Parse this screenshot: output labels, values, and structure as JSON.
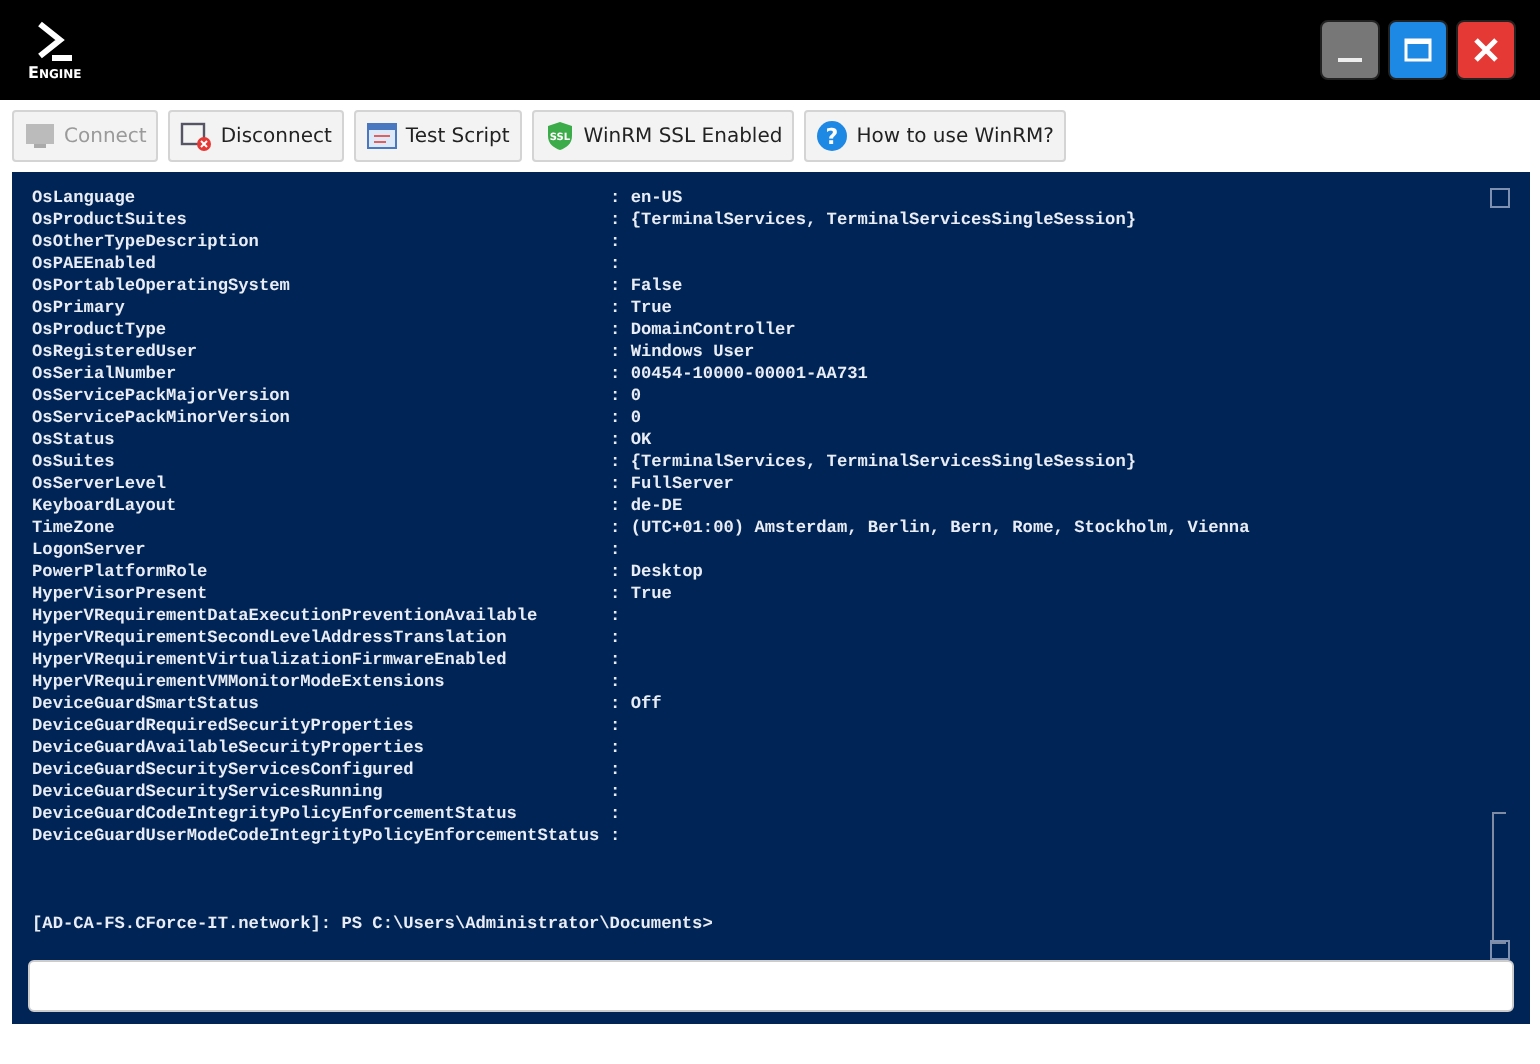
{
  "logo": {
    "text": "Engine"
  },
  "toolbar": [
    {
      "label": "Connect",
      "kind": "monitor",
      "disabled": true
    },
    {
      "label": "Disconnect",
      "kind": "disconnect",
      "disabled": false
    },
    {
      "label": "Test Script",
      "kind": "script",
      "disabled": false
    },
    {
      "label": "WinRM SSL Enabled",
      "kind": "shield",
      "icon_text": "SSL",
      "disabled": false
    },
    {
      "label": "How to use WinRM?",
      "kind": "help",
      "icon_text": "?",
      "disabled": false
    }
  ],
  "console": {
    "rows": [
      {
        "name": "OsLanguage",
        "value": ": en-US"
      },
      {
        "name": "OsProductSuites",
        "value": ": {TerminalServices, TerminalServicesSingleSession}"
      },
      {
        "name": "OsOtherTypeDescription",
        "value": ":"
      },
      {
        "name": "OsPAEEnabled",
        "value": ":"
      },
      {
        "name": "OsPortableOperatingSystem",
        "value": ": False"
      },
      {
        "name": "OsPrimary",
        "value": ": True"
      },
      {
        "name": "OsProductType",
        "value": ": DomainController"
      },
      {
        "name": "OsRegisteredUser",
        "value": ": Windows User"
      },
      {
        "name": "OsSerialNumber",
        "value": ": 00454-10000-00001-AA731"
      },
      {
        "name": "OsServicePackMajorVersion",
        "value": ": 0"
      },
      {
        "name": "OsServicePackMinorVersion",
        "value": ": 0"
      },
      {
        "name": "OsStatus",
        "value": ": OK"
      },
      {
        "name": "OsSuites",
        "value": ": {TerminalServices, TerminalServicesSingleSession}"
      },
      {
        "name": "OsServerLevel",
        "value": ": FullServer"
      },
      {
        "name": "KeyboardLayout",
        "value": ": de-DE"
      },
      {
        "name": "TimeZone",
        "value": ": (UTC+01:00) Amsterdam, Berlin, Bern, Rome, Stockholm, Vienna"
      },
      {
        "name": "LogonServer",
        "value": ":"
      },
      {
        "name": "PowerPlatformRole",
        "value": ": Desktop"
      },
      {
        "name": "HyperVisorPresent",
        "value": ": True"
      },
      {
        "name": "HyperVRequirementDataExecutionPreventionAvailable",
        "value": ":"
      },
      {
        "name": "HyperVRequirementSecondLevelAddressTranslation",
        "value": ":"
      },
      {
        "name": "HyperVRequirementVirtualizationFirmwareEnabled",
        "value": ":"
      },
      {
        "name": "HyperVRequirementVMMonitorModeExtensions",
        "value": ":"
      },
      {
        "name": "DeviceGuardSmartStatus",
        "value": ": Off"
      },
      {
        "name": "DeviceGuardRequiredSecurityProperties",
        "value": ":"
      },
      {
        "name": "DeviceGuardAvailableSecurityProperties",
        "value": ":"
      },
      {
        "name": "DeviceGuardSecurityServicesConfigured",
        "value": ":"
      },
      {
        "name": "DeviceGuardSecurityServicesRunning",
        "value": ":"
      },
      {
        "name": "DeviceGuardCodeIntegrityPolicyEnforcementStatus",
        "value": ":"
      },
      {
        "name": "DeviceGuardUserModeCodeIntegrityPolicyEnforcementStatus",
        "value": ":"
      }
    ],
    "prompt": "[AD-CA-FS.CForce-IT.network]: PS C:\\Users\\Administrator\\Documents>"
  }
}
